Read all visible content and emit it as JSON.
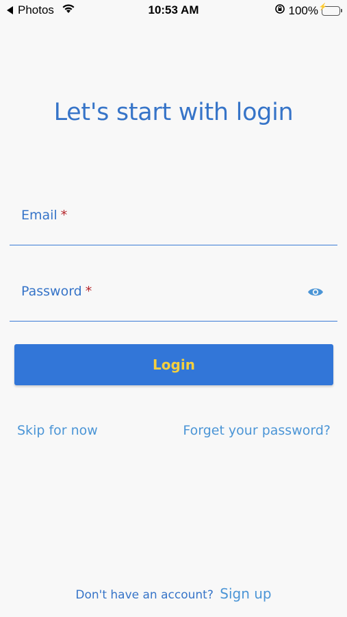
{
  "status_bar": {
    "back_app": "Photos",
    "time": "10:53 AM",
    "battery_percent": "100%"
  },
  "title": "Let's start with login",
  "form": {
    "email_label": "Email",
    "password_label": "Password",
    "required_marker": "*"
  },
  "login_button": "Login",
  "links": {
    "skip": "Skip for now",
    "forget": "Forget your password?"
  },
  "signup": {
    "prompt": "Don't have an account?",
    "link": "Sign up"
  },
  "colors": {
    "primary": "#3276d8",
    "title": "#3674c8",
    "link": "#4b95d6",
    "button_text": "#f3cf3e",
    "required": "#b5262b"
  },
  "icons": [
    "back-arrow-icon",
    "wifi-icon",
    "rotation-lock-icon",
    "battery-icon",
    "eye-icon"
  ]
}
